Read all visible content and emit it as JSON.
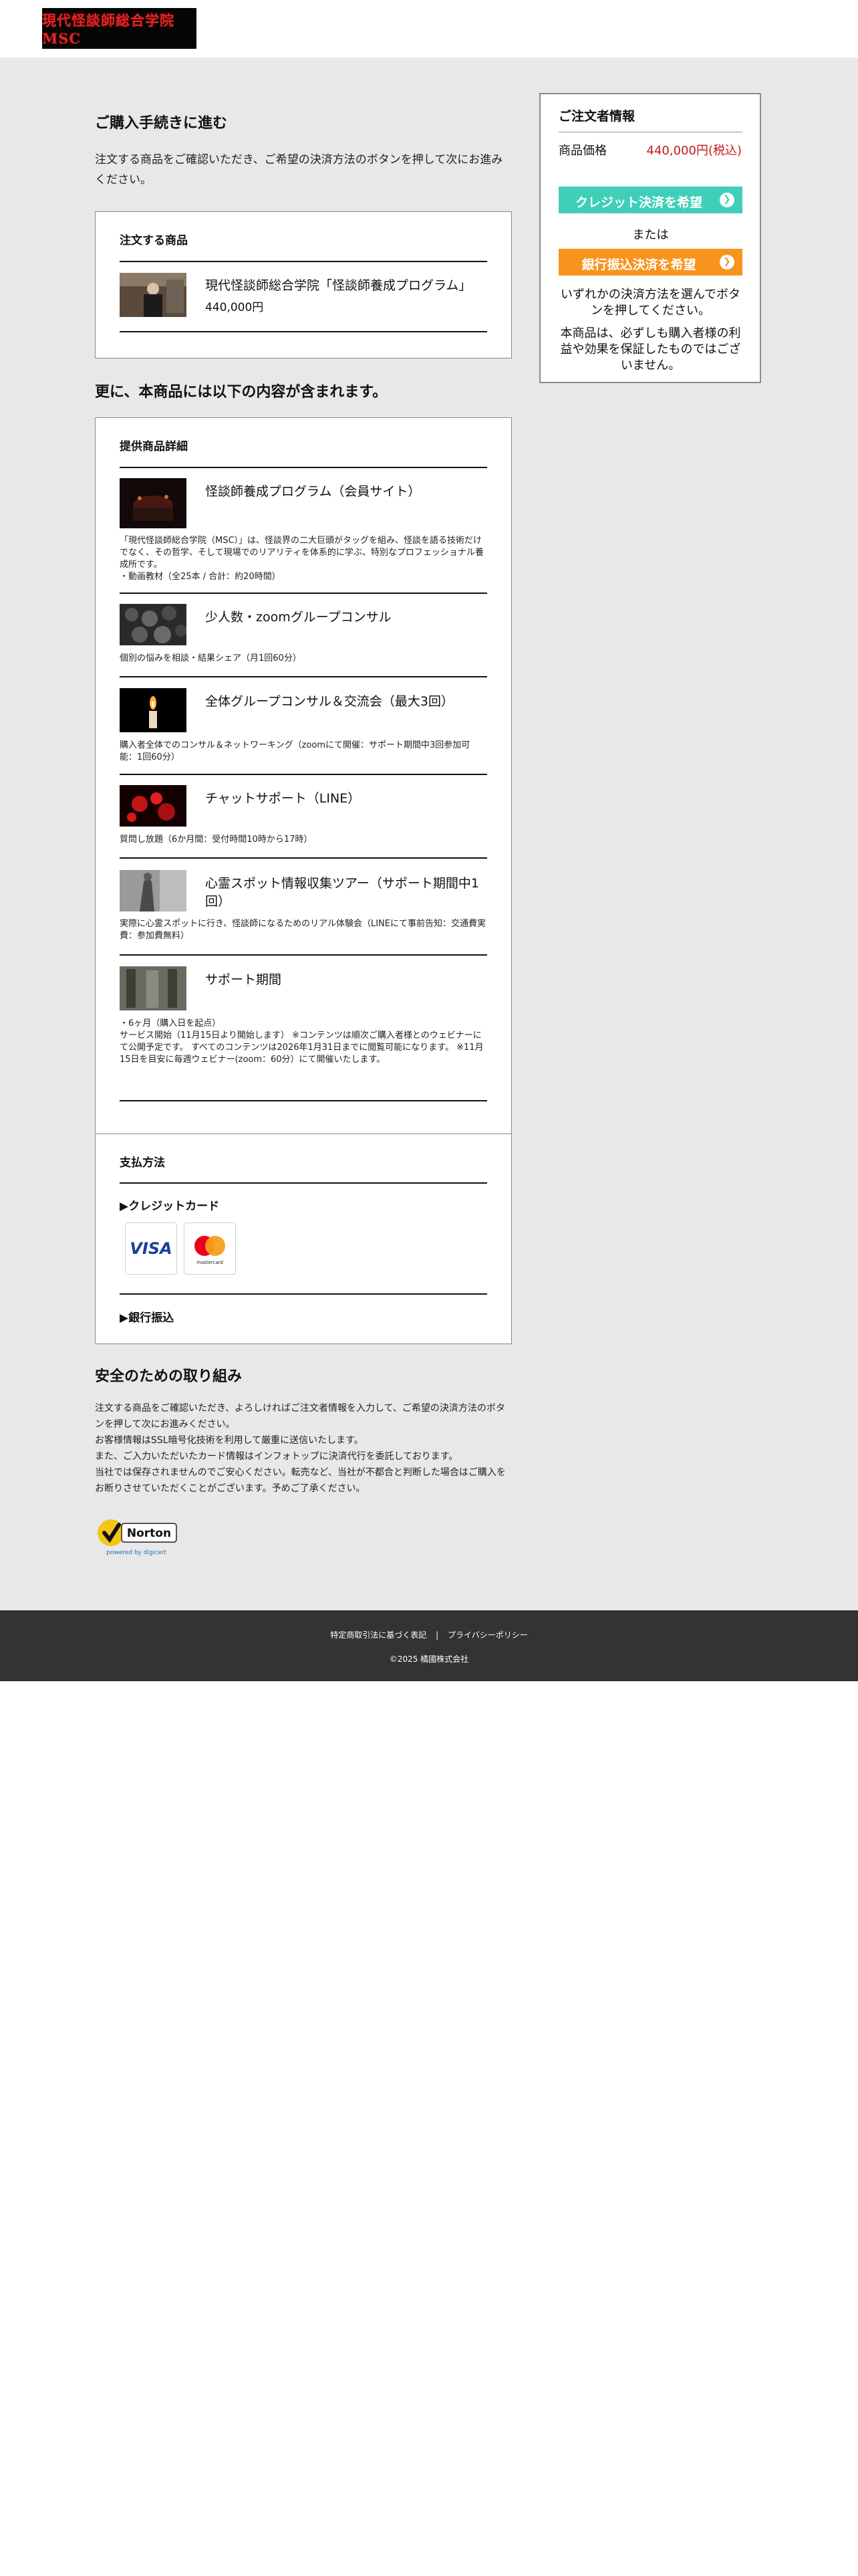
{
  "header": {
    "logo_text": "現代怪談師総合学院 MSC"
  },
  "main": {
    "title": "ご購入手続きに進む",
    "intro": "注文する商品をご確認いただき、ご希望の決済方法のボタンを押して次にお進みください。",
    "order": {
      "title": "注文する商品",
      "item_name": "現代怪談師総合学院「怪談師養成プログラム」",
      "item_price": "440,000円"
    },
    "includes_title": "更に、本商品には以下の内容が含まれます。",
    "details": {
      "title": "提供商品詳細",
      "items": [
        {
          "name": "怪談師養成プログラム（会員サイト）",
          "desc": "「現代怪談師総合学院（MSC）」は、怪談界の二大巨頭がタッグを組み、怪談を語る技術だけでなく、その哲学、そして現場でのリアリティを体系的に学ぶ、特別なプロフェッショナル養成所です。\n・動画教材（全25本 / 合計：約20時間）"
        },
        {
          "name": "少人数・zoomグループコンサル",
          "desc": "個別の悩みを相談・結果シェア（月1回60分）"
        },
        {
          "name": "全体グループコンサル＆交流会（最大3回）",
          "desc": "購入者全体でのコンサル＆ネットワーキング（zoomにて開催：サポート期間中3回参加可能：1回60分）"
        },
        {
          "name": "チャットサポート（LINE）",
          "desc": "質問し放題（6か月間：受付時間10時から17時）"
        },
        {
          "name": "心霊スポット情報収集ツアー（サポート期間中1回）",
          "desc": "実際に心霊スポットに行き、怪談師になるためのリアル体験会（LINEにて事前告知：交通費実費：参加費無料）"
        },
        {
          "name": "サポート期間",
          "desc": "・6ヶ月（購入日を起点）\nサービス開始（11月15日より開始します） ※コンテンツは順次ご購入者様とのウェビナーにて公開予定です。 すべてのコンテンツは2026年1月31日までに閲覧可能になります。 ※11月15日を目安に毎週ウェビナー(zoom：60分）にて開催いたします。"
        }
      ]
    },
    "payment": {
      "title": "支払方法",
      "credit_label": "▶クレジットカード",
      "visa_text": "VISA",
      "mastercard_text": "mastercard",
      "bank_label": "▶銀行振込"
    },
    "security": {
      "title": "安全のための取り組み",
      "lines": [
        "注文する商品をご確認いただき、よろしければご注文者情報を入力して、ご希望の決済方法のボタンを押して次にお進みください。",
        "お客様情報はSSL暗号化技術を利用して厳重に送信いたします。",
        "また、ご入力いただいたカード情報はインフォトップに決済代行を委託しております。",
        "当社では保存されませんのでご安心ください。転売など、当社が不都合と判断した場合はご購入をお断りさせていただくことがございます。予めご了承ください。"
      ],
      "norton_text": "Norton",
      "norton_sub": "powered by digicert"
    }
  },
  "sidebar": {
    "title": "ご注文者情報",
    "price_label": "商品価格",
    "price_value": "440,000円(税込)",
    "credit_button": "クレジット決済を希望",
    "or_text": "または",
    "bank_button": "銀行振込決済を希望",
    "note1": "いずれかの決済方法を選んでボタンを押してください。",
    "note2": "本商品は、必ずしも購入者様の利益や効果を保証したものではございません。"
  },
  "footer": {
    "link1": "特定商取引法に基づく表記",
    "separator": "|",
    "link2": "プライバシーポリシー",
    "copyright": "©2025 橘國株式会社"
  },
  "colors": {
    "credit_button": "#3fcfb9",
    "bank_button": "#f6941e",
    "price_red": "#c31a1a",
    "footer_bg": "#333333",
    "main_bg": "#e8e8e8"
  }
}
